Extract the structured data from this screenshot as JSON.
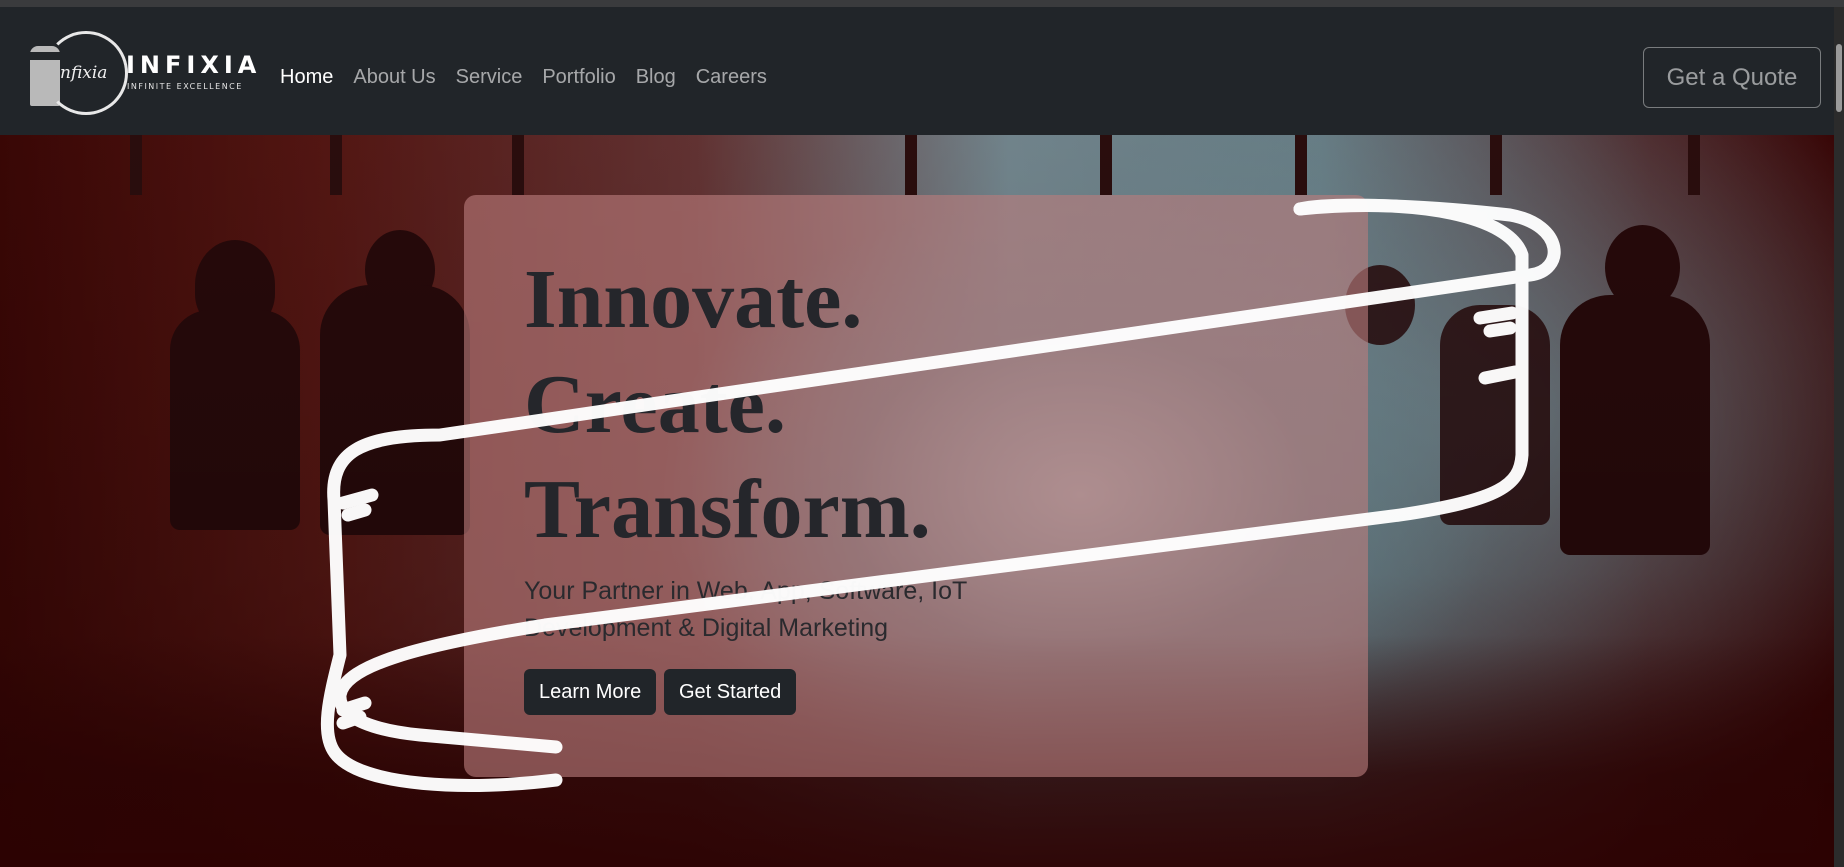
{
  "brand": {
    "script_mark": "nfixia",
    "name": "INFIXIA",
    "tagline": "INFINITE EXCELLENCE"
  },
  "nav": {
    "items": [
      {
        "label": "Home",
        "active": true
      },
      {
        "label": "About Us",
        "active": false
      },
      {
        "label": "Service",
        "active": false
      },
      {
        "label": "Portfolio",
        "active": false
      },
      {
        "label": "Blog",
        "active": false
      },
      {
        "label": "Careers",
        "active": false
      }
    ],
    "cta_label": "Get a Quote"
  },
  "hero": {
    "headline": [
      "Innovate.",
      "Create.",
      "Transform."
    ],
    "subtitle": "Your Partner in Web, App, Software, IoT Development & Digital Marketing",
    "buttons": {
      "learn_more": "Learn More",
      "get_started": "Get Started"
    }
  },
  "colors": {
    "navbar_bg": "#212529",
    "button_bg": "#212529",
    "headline": "#25262b",
    "card_tint": "#b97d7d"
  },
  "icons": [
    "logo-pillar-icon",
    "logo-ring-icon",
    "scroll-ribbon-graphic"
  ]
}
